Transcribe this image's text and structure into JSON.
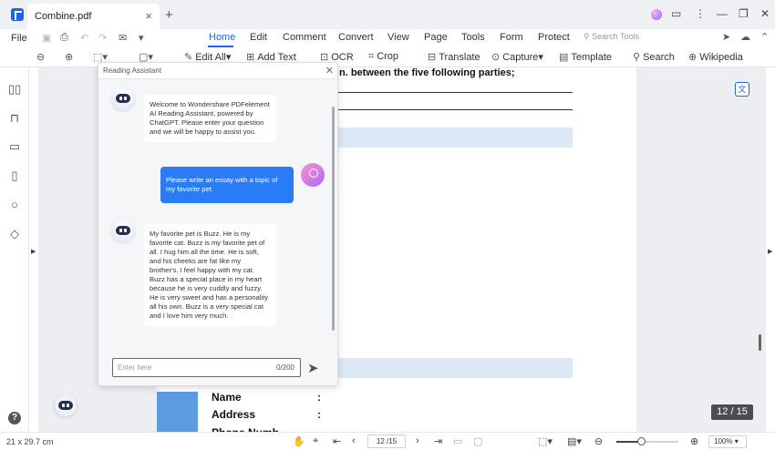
{
  "titlebar": {
    "tab_title": "Combine.pdf",
    "tab_close": "×",
    "new_tab": "+",
    "window_buttons": [
      "⋮",
      "—",
      "❐",
      "✕"
    ]
  },
  "menu": {
    "file": "File",
    "items": [
      "Home",
      "Edit",
      "Comment",
      "Convert",
      "View",
      "Page",
      "Tools",
      "Form",
      "Protect"
    ],
    "active": "Home",
    "search_tools": "Search Tools"
  },
  "ribbon": {
    "edit_all": "Edit All",
    "add_text": "Add Text",
    "ocr": "OCR",
    "crop": "Crop",
    "translate": "Translate",
    "capture": "Capture",
    "template": "Template",
    "search": "Search",
    "wikipedia": "Wikipedia"
  },
  "document": {
    "heading": "n. between the five following parties;",
    "fields": [
      "Name",
      "Address",
      "Phone Numb"
    ],
    "colon": ":",
    "page_counter": "12 / 15"
  },
  "assistant": {
    "title": "Reading Assistant",
    "close": "✕",
    "welcome": "Welcome to Wondershare PDFelement AI Reading Assistant, powered by ChatGPT. Please enter your question and we will be happy to assist you.",
    "user_message": "Please write an essay with a topic of my favorite pet.",
    "bot_reply": "My favorite pet is Buzz. He is my favorite cat. Buzz is my favorite pet of all. I hug him all the time. He is soft, and his cheeks are fat like my brother's. I feel happy with my cat. Buzz has a special place in my heart because he is very cuddly and fuzzy. He is very sweet and has a personality all his own. Buzz is a very special cat and I love him very much.",
    "input_placeholder": "Enter here",
    "input_count": "0/200"
  },
  "statusbar": {
    "page_size": "21 x 29.7 cm",
    "page_input": "12 /15",
    "zoom": "100%",
    "zoom_fraction": 0.4
  },
  "colors": {
    "accent": "#1f64e6",
    "user_bubble": "#2a7bf6",
    "band": "#dce8f5"
  }
}
